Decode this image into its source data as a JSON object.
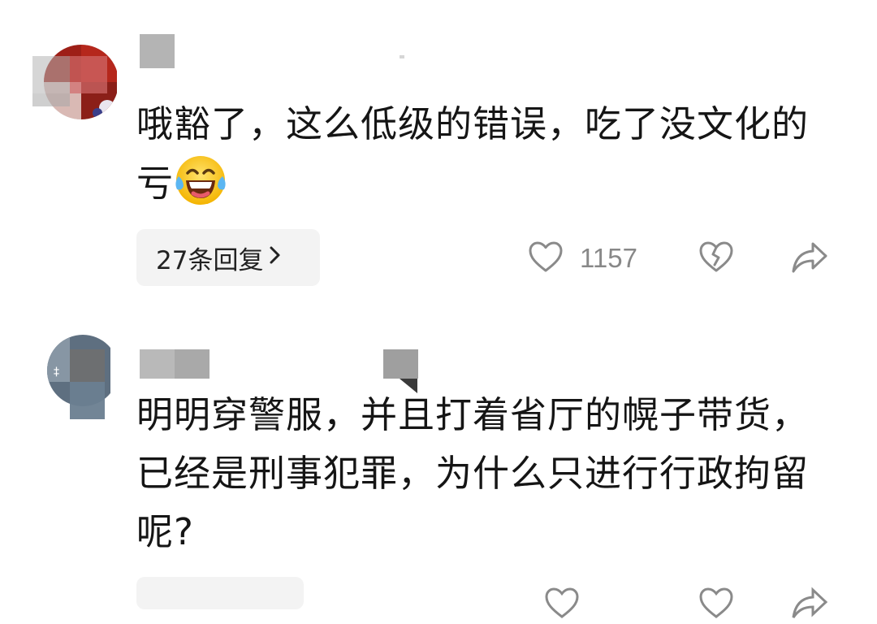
{
  "comments": [
    {
      "text": "哦豁了，这么低级的错误，吃了没文化的亏",
      "emoji": "laughing-tears-emoji",
      "replies_label": "27条回复",
      "like_count": "1157",
      "avatar_colors": [
        "#b3261e",
        "#7a1a14",
        "#e6c9c4"
      ]
    },
    {
      "text": "明明穿警服，并且打着省厅的幌子带货，已经是刑事犯罪，为什么只进行行政拘留呢?",
      "avatar_colors": [
        "#6f8191",
        "#4d5e6e",
        "#d8dde2"
      ]
    }
  ],
  "icons": {
    "like": "heart-outline-icon",
    "dislike": "broken-heart-icon",
    "share": "share-arrow-icon"
  },
  "colors": {
    "icon_gray": "#8a8a8a",
    "reply_bg": "#f3f3f3"
  }
}
